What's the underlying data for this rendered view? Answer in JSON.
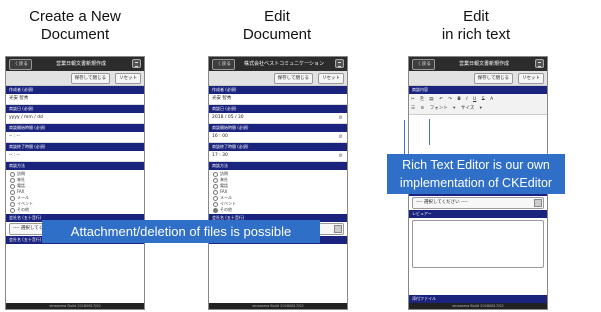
{
  "captions": [
    {
      "line1": "Create a New",
      "line2": "Document"
    },
    {
      "line1": "Edit",
      "line2": "Document"
    },
    {
      "line1": "Edit",
      "line2": "in rich text"
    }
  ],
  "screen1": {
    "back": "〈 戻る",
    "title": "営業日報文書新規作成",
    "save": "保存して閉じる",
    "reset": "リセット",
    "fields": [
      {
        "label": "作成者 (必須)",
        "value": "光安 智秀"
      },
      {
        "label": "商談日 (必須)",
        "value": "yyyy / mm / dd"
      },
      {
        "label": "商談開始時間 (必須)",
        "value": "-- : --"
      },
      {
        "label": "商談終了時間 (必須)",
        "value": "-- : --"
      }
    ],
    "method_label": "商談方法",
    "methods": [
      "訪問",
      "来社",
      "電話",
      "FAX",
      "メール",
      "イベント",
      "その他"
    ],
    "company_label": "会社名 (五十音行)",
    "select_placeholder": "---- 選択してください ----",
    "company_label2": "会社名 (五十音行)",
    "footer": "smazoma Build 20180817/02"
  },
  "screen2": {
    "back": "〈 戻る",
    "title": "株式会社ベストコミュニケーション",
    "save": "保存して閉じる",
    "reset": "リセット",
    "fields": [
      {
        "label": "作成者 (必須)",
        "value": "光安 智秀"
      },
      {
        "label": "商談日 (必須)",
        "value": "2018 / 05 / 30"
      },
      {
        "label": "商談開始時間 (必須)",
        "value": "16 : 00"
      },
      {
        "label": "商談終了時間 (必須)",
        "value": "17 : 30"
      }
    ],
    "method_label": "商談方法",
    "methods": [
      "訪問",
      "来社",
      "電話",
      "FAX",
      "メール",
      "イベント",
      "その他"
    ],
    "company_label": "会社名 (五十音行)",
    "select_placeholder": "---- 選択してください ----",
    "company_label2": "会社名 (五十音行)",
    "footer": "smazoma Build 20180817/02"
  },
  "screen3": {
    "back": "〈 戻る",
    "title": "営業日報文書新規作成",
    "save": "保存して閉じる",
    "reset": "リセット",
    "content_label": "商談内容",
    "font_label": "フォント",
    "size_label": "サイズ",
    "reviewer_label": "レビュアー (五十音行)",
    "select_placeholder": "---- 選択してください ----",
    "reviewer_label2": "レビュアー",
    "attach_label": "添付ファイル",
    "footer": "smazoma Build 20180817/02"
  },
  "overlays": {
    "attachment": "Attachment/deletion of files is possible",
    "rte_line1": "Rich Text Editor is our own",
    "rte_line2": "implementation of CKEditor"
  },
  "colors": {
    "accent": "#2f6fc7",
    "header": "#1a237e",
    "topbar": "#2c2c2c"
  }
}
